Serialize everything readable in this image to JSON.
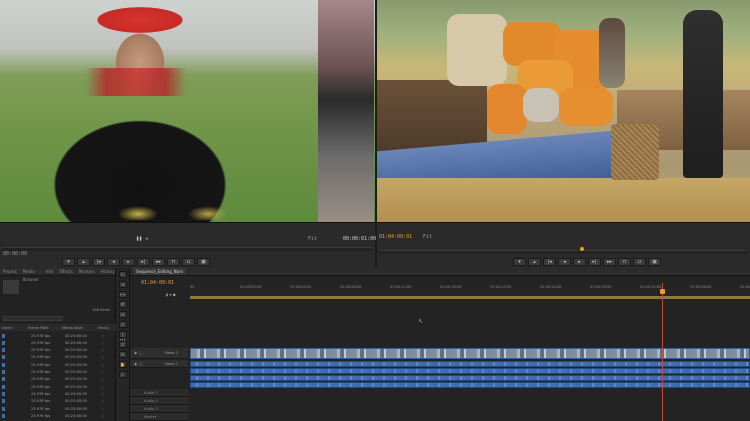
{
  "source_monitor": {
    "timecode_left": "00:00:00",
    "timecode_right": "00:00:01:00",
    "zoom": "Fit"
  },
  "program_monitor": {
    "timecode": "01:04:00:01",
    "zoom": "Fit"
  },
  "transport_icons": [
    "mark-in-icon",
    "mark-out-icon",
    "go-to-in-icon",
    "step-back-icon",
    "play-icon",
    "step-forward-icon",
    "go-to-out-icon",
    "insert-icon",
    "overwrite-icon",
    "export-frame-icon"
  ],
  "project_panel": {
    "tabs": [
      "Project",
      "Media Browser",
      "Info",
      "Effects",
      "Markers",
      "History"
    ],
    "item_count": "108 Items",
    "columns": [
      "Name",
      "Frame Rate",
      "Media Start",
      "Media"
    ],
    "rows": [
      {
        "name": "",
        "rate": "23.976 fps",
        "start": "00:23:00:00"
      },
      {
        "name": "",
        "rate": "23.976 fps",
        "start": "00:23:00:00"
      },
      {
        "name": "",
        "rate": "23.976 fps",
        "start": "00:23:00:00"
      },
      {
        "name": "",
        "rate": "23.976 fps",
        "start": "00:23:00:00"
      },
      {
        "name": "",
        "rate": "23.976 fps",
        "start": "00:23:00:00"
      },
      {
        "name": "",
        "rate": "23.976 fps",
        "start": "00:23:00:00"
      },
      {
        "name": "",
        "rate": "23.976 fps",
        "start": "00:23:00:00"
      },
      {
        "name": "",
        "rate": "23.976 fps",
        "start": "00:23:00:00"
      },
      {
        "name": "",
        "rate": "23.976 fps",
        "start": "00:23:00:00"
      },
      {
        "name": "",
        "rate": "23.976 fps",
        "start": "00:23:00:00"
      },
      {
        "name": "",
        "rate": "23.976 fps",
        "start": "00:23:00:00"
      },
      {
        "name": "",
        "rate": "23.976 fps",
        "start": "00:23:00:00"
      }
    ]
  },
  "timeline": {
    "sequence_tab": "Sequence_Editing_Nom",
    "timecode": "01:04:00:01",
    "ruler": [
      "00",
      "01:00:00:00",
      "01:00:04:00",
      "01:00:08:00",
      "01:00:12:00",
      "01:00:16:00",
      "01:00:20:00",
      "01:00:24:00",
      "01:00:28:00",
      "01:00:32:00",
      "01:00:36:00",
      "01:00:40:00"
    ],
    "tracks": {
      "video": [
        "Video 2",
        "Video 1"
      ],
      "audio": [
        "Audio 1",
        "Audio 2",
        "Audio 3",
        "Audio 4",
        "Master"
      ]
    }
  },
  "colors": {
    "playhead": "#e7a12b",
    "video_clip": "#7f8fa3",
    "audio_clip": "#3d6cae",
    "accent_timecode": "#e7a12b"
  }
}
